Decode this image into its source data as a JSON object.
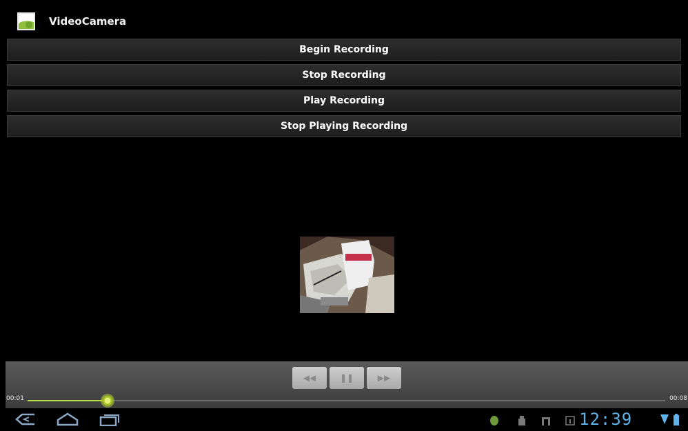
{
  "app": {
    "title": "VideoCamera"
  },
  "buttons": {
    "begin": "Begin Recording",
    "stop": "Stop Recording",
    "play": "Play Recording",
    "stop_playing": "Stop Playing Recording"
  },
  "player": {
    "elapsed": "00:01",
    "duration": "00:08",
    "progress": 0.125,
    "rewind_icon": "rewind-icon",
    "pause_icon": "pause-icon",
    "forward_icon": "fast-forward-icon"
  },
  "status": {
    "time": "12:39",
    "accent": "#5fb3e8"
  }
}
